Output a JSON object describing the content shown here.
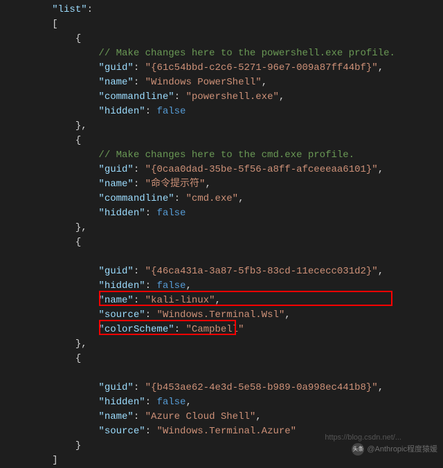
{
  "code": {
    "list_key": "\"list\"",
    "colon": ":",
    "comma": ",",
    "obr": "[",
    "cbr": "]",
    "ocb": "{",
    "ccb": "}",
    "ccbc": "},",
    "entries": [
      {
        "comment": "// Make changes here to the powershell.exe profile.",
        "guid_k": "\"guid\"",
        "guid_v": "\"{61c54bbd-c2c6-5271-96e7-009a87ff44bf}\"",
        "name_k": "\"name\"",
        "name_v": "\"Windows PowerShell\"",
        "cmd_k": "\"commandline\"",
        "cmd_v": "\"powershell.exe\"",
        "hidden_k": "\"hidden\"",
        "hidden_v": "false"
      },
      {
        "comment": "// Make changes here to the cmd.exe profile.",
        "guid_k": "\"guid\"",
        "guid_v": "\"{0caa0dad-35be-5f56-a8ff-afceeeaa6101}\"",
        "name_k": "\"name\"",
        "name_v": "\"命令提示符\"",
        "cmd_k": "\"commandline\"",
        "cmd_v": "\"cmd.exe\"",
        "hidden_k": "\"hidden\"",
        "hidden_v": "false"
      },
      {
        "guid_k": "\"guid\"",
        "guid_v": "\"{46ca431a-3a87-5fb3-83cd-11ececc031d2}\"",
        "hidden_k": "\"hidden\"",
        "hidden_v": "false",
        "name_k": "\"name\"",
        "name_v": "\"kali-linux\"",
        "src_k": "\"source\"",
        "src_v": "\"Windows.Terminal.Wsl\"",
        "scheme_k": "\"colorScheme\"",
        "scheme_v": "\"Campbell\""
      },
      {
        "guid_k": "\"guid\"",
        "guid_v": "\"{b453ae62-4e3d-5e58-b989-0a998ec441b8}\"",
        "hidden_k": "\"hidden\"",
        "hidden_v": "false",
        "name_k": "\"name\"",
        "name_v": "\"Azure Cloud Shell\"",
        "src_k": "\"source\"",
        "src_v": "\"Windows.Terminal.Azure\""
      }
    ]
  },
  "watermark": {
    "text": "@Anthropic程度猿媛",
    "url": "https://blog.csdn.net/..."
  }
}
